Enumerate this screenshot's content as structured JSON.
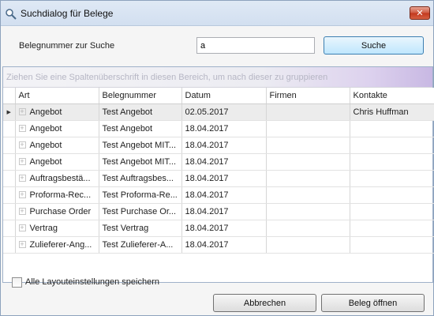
{
  "window": {
    "title": "Suchdialog für Belege",
    "close_label": "✕"
  },
  "search": {
    "label": "Belegnummer zur Suche",
    "value": "a",
    "button": "Suche"
  },
  "grid": {
    "group_hint": "Ziehen Sie eine Spaltenüberschrift in diesen Bereich, um nach dieser zu gruppieren",
    "columns": [
      "Art",
      "Belegnummer",
      "Datum",
      "Firmen",
      "Kontakte"
    ],
    "rows": [
      [
        "Angebot",
        "Test Angebot",
        "02.05.2017",
        "",
        "Chris Huffman"
      ],
      [
        "Angebot",
        "Test Angebot",
        "18.04.2017",
        "",
        ""
      ],
      [
        "Angebot",
        "Test Angebot MIT...",
        "18.04.2017",
        "",
        ""
      ],
      [
        "Angebot",
        "Test Angebot MIT...",
        "18.04.2017",
        "",
        ""
      ],
      [
        "Auftragsbestä...",
        "Test Auftragsbes...",
        "18.04.2017",
        "",
        ""
      ],
      [
        "Proforma-Rec...",
        "Test Proforma-Re...",
        "18.04.2017",
        "",
        ""
      ],
      [
        "Purchase Order",
        "Test Purchase Or...",
        "18.04.2017",
        "",
        ""
      ],
      [
        "Vertrag",
        "Test Vertrag",
        "18.04.2017",
        "",
        ""
      ],
      [
        "Zulieferer-Ang...",
        "Test Zulieferer-A...",
        "18.04.2017",
        "",
        ""
      ]
    ]
  },
  "footer": {
    "checkbox_label": "Alle Layouteinstellungen speichern",
    "checkbox_checked": false,
    "cancel": "Abbrechen",
    "open": "Beleg öffnen"
  },
  "colors": {
    "accent": "#3c7fb1",
    "close": "#c3381d",
    "group_panel": "#c8b8e3"
  },
  "icons": {
    "app": "search-magnifier-icon",
    "expander": "plus-expander-icon",
    "row_indicator": "triangle-right-icon"
  }
}
